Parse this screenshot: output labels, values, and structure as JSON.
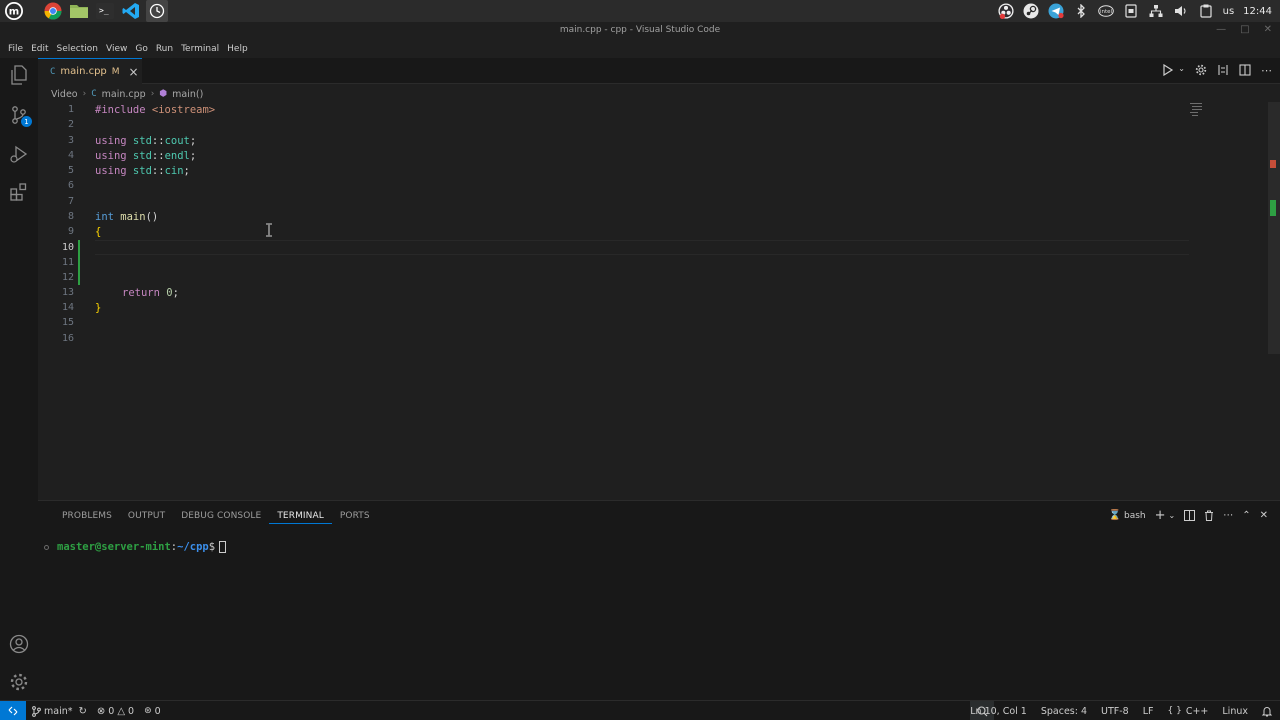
{
  "window": {
    "title": "main.cpp - cpp - Visual Studio Code"
  },
  "taskbar": {
    "apps": [
      {
        "name": "mint-menu"
      },
      {
        "name": "chrome"
      },
      {
        "name": "files"
      },
      {
        "name": "terminal"
      },
      {
        "name": "vscode"
      },
      {
        "name": "clock-app"
      }
    ],
    "tray": {
      "keyboard_layout": "us",
      "clock": "12:44"
    }
  },
  "menu": [
    "File",
    "Edit",
    "Selection",
    "View",
    "Go",
    "Run",
    "Terminal",
    "Help"
  ],
  "activity_bar": {
    "source_control_badge": "1"
  },
  "tab": {
    "label": "main.cpp",
    "modified": "M",
    "icon": "C"
  },
  "breadcrumb": {
    "folder": "Video",
    "file": "main.cpp",
    "symbol": "main()"
  },
  "editor": {
    "active_line": 10,
    "lines": [
      {
        "n": "1"
      },
      {
        "n": "2"
      },
      {
        "n": "3"
      },
      {
        "n": "4"
      },
      {
        "n": "5"
      },
      {
        "n": "6"
      },
      {
        "n": "7"
      },
      {
        "n": "8"
      },
      {
        "n": "9"
      },
      {
        "n": "10"
      },
      {
        "n": "11"
      },
      {
        "n": "12"
      },
      {
        "n": "13"
      },
      {
        "n": "14"
      },
      {
        "n": "15"
      },
      {
        "n": "16"
      }
    ],
    "code": {
      "l1_pre": "#include",
      "l1_hdr": " <iostream>",
      "l3_kw": "using",
      "l3_ns": " std",
      "l3_op": "::",
      "l3_id": "cout",
      "l4_id": "endl",
      "l5_id": "cin",
      "semi": ";",
      "l8_kw": "int",
      "l8_fn": " main",
      "l8_paren": "()",
      "open_brace": "{",
      "l13_kw": "return",
      "l13_num": " 0",
      "close_brace": "}"
    }
  },
  "panel": {
    "tabs": [
      "PROBLEMS",
      "OUTPUT",
      "DEBUG CONSOLE",
      "TERMINAL",
      "PORTS"
    ],
    "active_tab": "TERMINAL",
    "terminal_name": "bash",
    "prompt_user": "master@server-mint",
    "prompt_sep": ":",
    "prompt_path": "~/cpp",
    "prompt_symbol": "$"
  },
  "statusbar": {
    "branch": "main*",
    "errors": "0",
    "warnings": "0",
    "ports": "0",
    "position": "Ln 10, Col 1",
    "spaces": "Spaces: 4",
    "encoding": "UTF-8",
    "eol": "LF",
    "language": "C++",
    "platform": "Linux"
  }
}
